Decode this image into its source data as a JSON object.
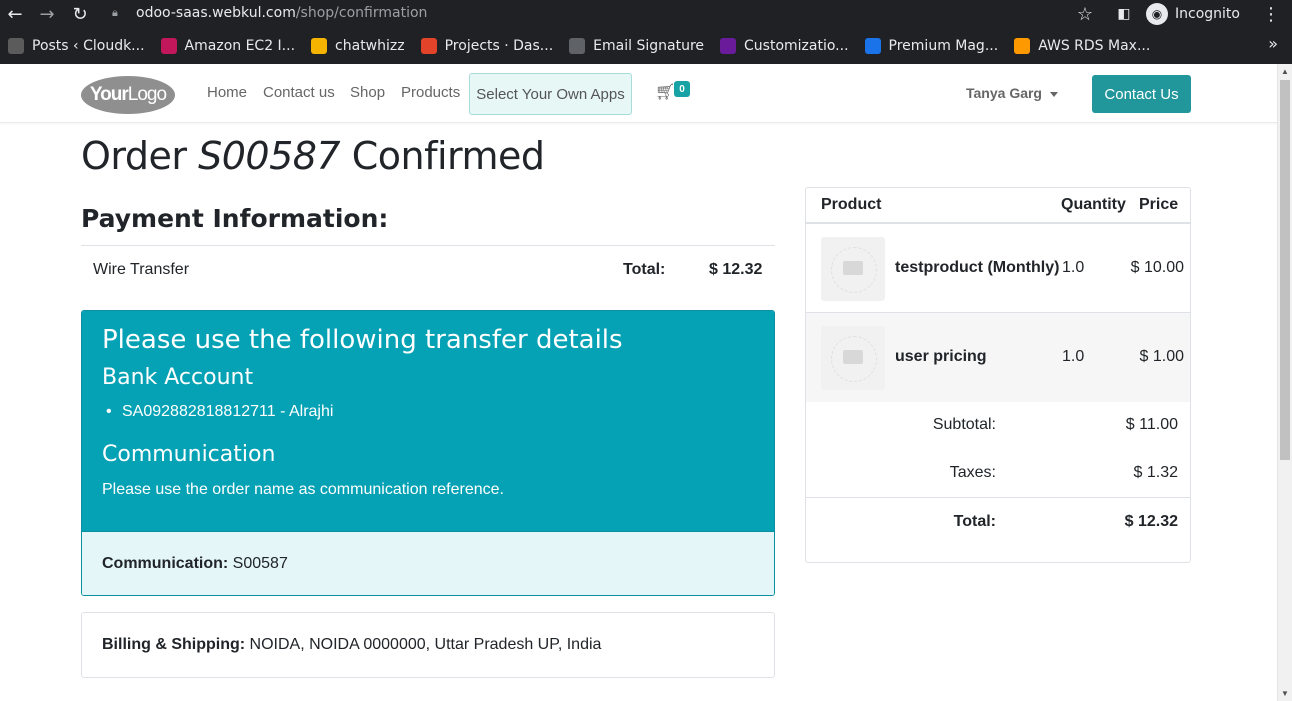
{
  "browser": {
    "url_host": "odoo-saas.webkul.com",
    "url_path": "/shop/confirmation",
    "incognito_label": "Incognito",
    "bookmarks": [
      {
        "label": "Posts ‹ Cloudk...",
        "icon": "wordpress-icon",
        "color": "#5b5b5b"
      },
      {
        "label": "Amazon EC2 I...",
        "icon": "amazon-ec2-icon",
        "color": "#c2185b"
      },
      {
        "label": "chatwhizz",
        "icon": "chatwhizz-icon",
        "color": "#f4b400"
      },
      {
        "label": "Projects · Das...",
        "icon": "gitlab-icon",
        "color": "#e24329"
      },
      {
        "label": "Email Signature",
        "icon": "globe-icon",
        "color": "#5f6368"
      },
      {
        "label": "Customizatio...",
        "icon": "customization-icon",
        "color": "#6a1b9a"
      },
      {
        "label": "Premium Mag...",
        "icon": "premium-icon",
        "color": "#1a73e8"
      },
      {
        "label": "AWS RDS Max...",
        "icon": "aws-rds-icon",
        "color": "#ff9900"
      }
    ]
  },
  "header": {
    "logo_text_bold": "Your",
    "logo_text": "Logo",
    "nav": [
      "Home",
      "Contact us",
      "Shop",
      "Products"
    ],
    "apps_button": "Select Your Own Apps",
    "cart_count": "0",
    "user_name": "Tanya Garg",
    "contact_button": "Contact Us"
  },
  "order": {
    "title_prefix": "Order",
    "order_ref": "S00587",
    "title_suffix": "Confirmed"
  },
  "payment": {
    "heading": "Payment Information:",
    "method": "Wire Transfer",
    "total_label": "Total:",
    "total_value": "$ 12.32"
  },
  "transfer": {
    "heading": "Please use the following transfer details",
    "bank_heading": "Bank Account",
    "account": "SA092882818812711 - Alrajhi",
    "comm_heading": "Communication",
    "comm_note": "Please use the order name as communication reference.",
    "comm_label": "Communication:",
    "comm_value": "S00587"
  },
  "billing": {
    "label": "Billing & Shipping:",
    "address": "NOIDA, NOIDA 0000000, Uttar Pradesh UP, India"
  },
  "summary": {
    "columns": [
      "Product",
      "Quantity",
      "Price"
    ],
    "items": [
      {
        "name": "testproduct (Monthly)",
        "qty": "1.0",
        "price": "$ 10.00"
      },
      {
        "name": "user pricing",
        "qty": "1.0",
        "price": "$ 1.00"
      }
    ],
    "subtotal_label": "Subtotal:",
    "subtotal_value": "$ 11.00",
    "taxes_label": "Taxes:",
    "taxes_value": "$ 1.32",
    "total_label": "Total:",
    "total_value": "$ 12.32"
  },
  "colors": {
    "accent": "#05a1b4",
    "button": "#21969b"
  }
}
